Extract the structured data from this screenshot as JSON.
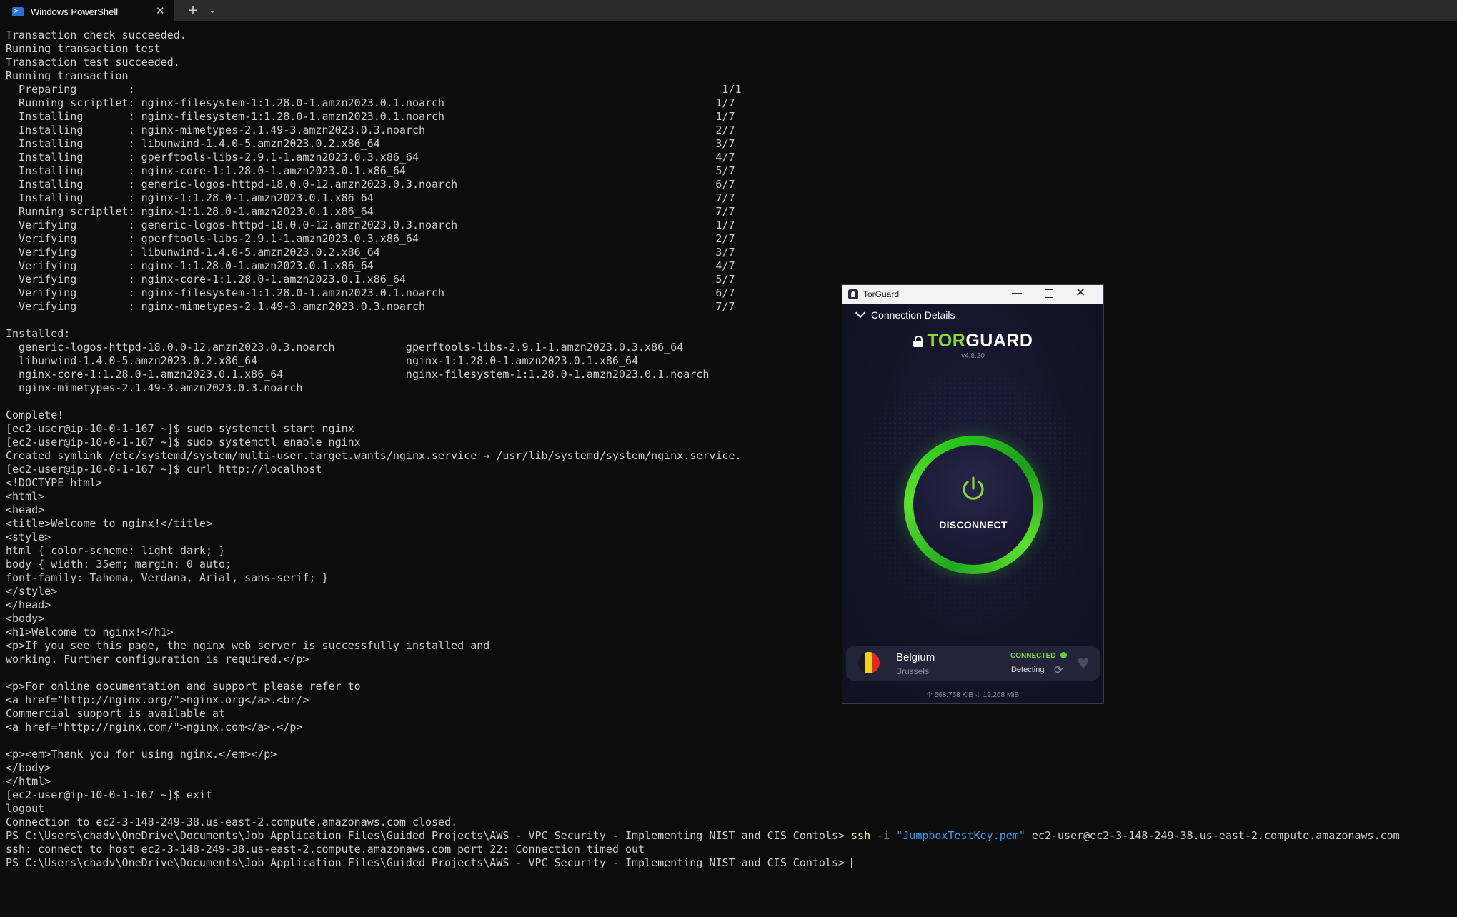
{
  "tab": {
    "title": "Windows PowerShell",
    "icon": "powershell-icon"
  },
  "terminal_lines": [
    "Transaction check succeeded.",
    "Running transaction test",
    "Transaction test succeeded.",
    "Running transaction",
    "  Preparing        :                                                                                           1/1",
    "  Running scriptlet: nginx-filesystem-1:1.28.0-1.amzn2023.0.1.noarch                                          1/7",
    "  Installing       : nginx-filesystem-1:1.28.0-1.amzn2023.0.1.noarch                                          1/7",
    "  Installing       : nginx-mimetypes-2.1.49-3.amzn2023.0.3.noarch                                             2/7",
    "  Installing       : libunwind-1.4.0-5.amzn2023.0.2.x86_64                                                    3/7",
    "  Installing       : gperftools-libs-2.9.1-1.amzn2023.0.3.x86_64                                              4/7",
    "  Installing       : nginx-core-1:1.28.0-1.amzn2023.0.1.x86_64                                                5/7",
    "  Installing       : generic-logos-httpd-18.0.0-12.amzn2023.0.3.noarch                                        6/7",
    "  Installing       : nginx-1:1.28.0-1.amzn2023.0.1.x86_64                                                     7/7",
    "  Running scriptlet: nginx-1:1.28.0-1.amzn2023.0.1.x86_64                                                     7/7",
    "  Verifying        : generic-logos-httpd-18.0.0-12.amzn2023.0.3.noarch                                        1/7",
    "  Verifying        : gperftools-libs-2.9.1-1.amzn2023.0.3.x86_64                                              2/7",
    "  Verifying        : libunwind-1.4.0-5.amzn2023.0.2.x86_64                                                    3/7",
    "  Verifying        : nginx-1:1.28.0-1.amzn2023.0.1.x86_64                                                     4/7",
    "  Verifying        : nginx-core-1:1.28.0-1.amzn2023.0.1.x86_64                                                5/7",
    "  Verifying        : nginx-filesystem-1:1.28.0-1.amzn2023.0.1.noarch                                          6/7",
    "  Verifying        : nginx-mimetypes-2.1.49-3.amzn2023.0.3.noarch                                             7/7",
    "",
    "Installed:",
    "  generic-logos-httpd-18.0.0-12.amzn2023.0.3.noarch           gperftools-libs-2.9.1-1.amzn2023.0.3.x86_64",
    "  libunwind-1.4.0-5.amzn2023.0.2.x86_64                       nginx-1:1.28.0-1.amzn2023.0.1.x86_64",
    "  nginx-core-1:1.28.0-1.amzn2023.0.1.x86_64                   nginx-filesystem-1:1.28.0-1.amzn2023.0.1.noarch",
    "  nginx-mimetypes-2.1.49-3.amzn2023.0.3.noarch",
    "",
    "Complete!",
    "[ec2-user@ip-10-0-1-167 ~]$ sudo systemctl start nginx",
    "[ec2-user@ip-10-0-1-167 ~]$ sudo systemctl enable nginx",
    "Created symlink /etc/systemd/system/multi-user.target.wants/nginx.service → /usr/lib/systemd/system/nginx.service.",
    "[ec2-user@ip-10-0-1-167 ~]$ curl http://localhost",
    "<!DOCTYPE html>",
    "<html>",
    "<head>",
    "<title>Welcome to nginx!</title>",
    "<style>",
    "html { color-scheme: light dark; }",
    "body { width: 35em; margin: 0 auto;",
    "font-family: Tahoma, Verdana, Arial, sans-serif; }",
    "</style>",
    "</head>",
    "<body>",
    "<h1>Welcome to nginx!</h1>",
    "<p>If you see this page, the nginx web server is successfully installed and",
    "working. Further configuration is required.</p>",
    "",
    "<p>For online documentation and support please refer to",
    "<a href=\"http://nginx.org/\">nginx.org</a>.<br/>",
    "Commercial support is available at",
    "<a href=\"http://nginx.com/\">nginx.com</a>.</p>",
    "",
    "<p><em>Thank you for using nginx.</em></p>",
    "</body>",
    "</html>",
    "[ec2-user@ip-10-0-1-167 ~]$ exit",
    "logout",
    "Connection to ec2-3-148-249-38.us-east-2.compute.amazonaws.com closed."
  ],
  "ssh_command": {
    "prompt": "PS C:\\Users\\chadv\\OneDrive\\Documents\\Job Application Files\\Guided Projects\\AWS - VPC Security - Implementing NIST and CIS Contols> ",
    "command": "ssh",
    "flag": " -i ",
    "key": "\"JumpboxTestKey.pem\"",
    "target": " ec2-user@ec2-3-148-249-38.us-east-2.compute.amazonaws.com"
  },
  "error_line": "ssh: connect to host ec2-3-148-249-38.us-east-2.compute.amazonaws.com port 22: Connection timed out",
  "final_prompt": "PS C:\\Users\\chadv\\OneDrive\\Documents\\Job Application Files\\Guided Projects\\AWS - VPC Security - Implementing NIST and CIS Contols> ",
  "torguard": {
    "window_title": "TorGuard",
    "connection_details_label": "Connection Details",
    "logo_tor": "TOR",
    "logo_guard": "GUARD",
    "version": "v4.8.20",
    "disconnect_label": "DISCONNECT",
    "location": {
      "country": "Belgium",
      "city": "Brussels",
      "status": "CONNECTED",
      "detecting": "Detecting",
      "flag_colors": [
        "#1a1a1a",
        "#f5d21a",
        "#e02a2a"
      ]
    },
    "upload": "568.758 KiB",
    "download": "19.268 MiB",
    "accent_color": "#5fe02f"
  }
}
